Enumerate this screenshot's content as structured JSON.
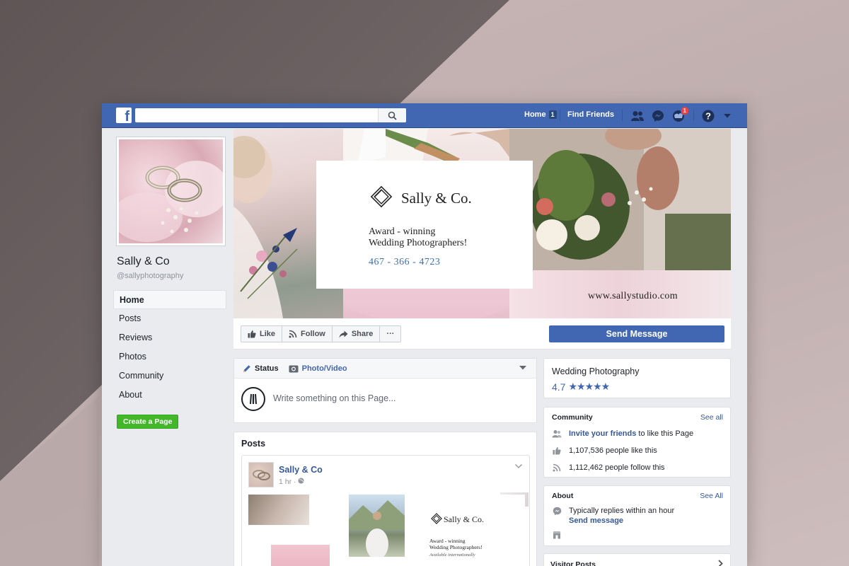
{
  "colors": {
    "fb_blue": "#4267b2",
    "link": "#365899",
    "green": "#42b72a",
    "phone": "#3b6fb6"
  },
  "topbar": {
    "logo": "f",
    "search_placeholder": "",
    "home_label": "Home",
    "home_count": "1",
    "find_friends_label": "Find Friends",
    "notification_count": "1",
    "icons": [
      "friend-requests-icon",
      "messenger-icon",
      "notifications-icon",
      "help-icon",
      "dropdown-arrow-icon"
    ]
  },
  "sidebar": {
    "page_name": "Sally & Co",
    "handle": "@sallyphotography",
    "items": [
      {
        "label": "Home",
        "active": true
      },
      {
        "label": "Posts"
      },
      {
        "label": "Reviews"
      },
      {
        "label": "Photos"
      },
      {
        "label": "Community"
      },
      {
        "label": "About"
      }
    ],
    "create_page_label": "Create a Page"
  },
  "cover": {
    "brand": "Sally & Co.",
    "award_line1": "Award - winning",
    "award_line2": "Wedding Photographers!",
    "phone": "467 - 366 - 4723",
    "website": "www.sallystudio.com"
  },
  "actions": {
    "like": "Like",
    "follow": "Follow",
    "share": "Share",
    "more": "···",
    "send_message": "Send Message"
  },
  "composer": {
    "status_tab": "Status",
    "photo_tab": "Photo/Video",
    "placeholder": "Write something on this Page..."
  },
  "posts": {
    "title": "Posts",
    "post": {
      "author": "Sally & Co",
      "time": "1 hr · ",
      "brand": "Sally & Co.",
      "award_line1": "Award - winning",
      "award_line2": "Wedding Photographers!",
      "available": "Available internationally"
    }
  },
  "rating": {
    "title": "Wedding Photography",
    "score": "4.7",
    "stars": "★★★★★"
  },
  "community": {
    "title": "Community",
    "see_all": "See all",
    "invite_link": "Invite your friends",
    "invite_rest": "to like this Page",
    "likes": "1,107,536 people like this",
    "follows": "1,112,462 people follow this"
  },
  "about": {
    "title": "About",
    "see_all": "See All",
    "replies": "Typically replies within an hour",
    "send_message": "Send message"
  },
  "visitor_posts": {
    "title": "Visitor Posts"
  }
}
